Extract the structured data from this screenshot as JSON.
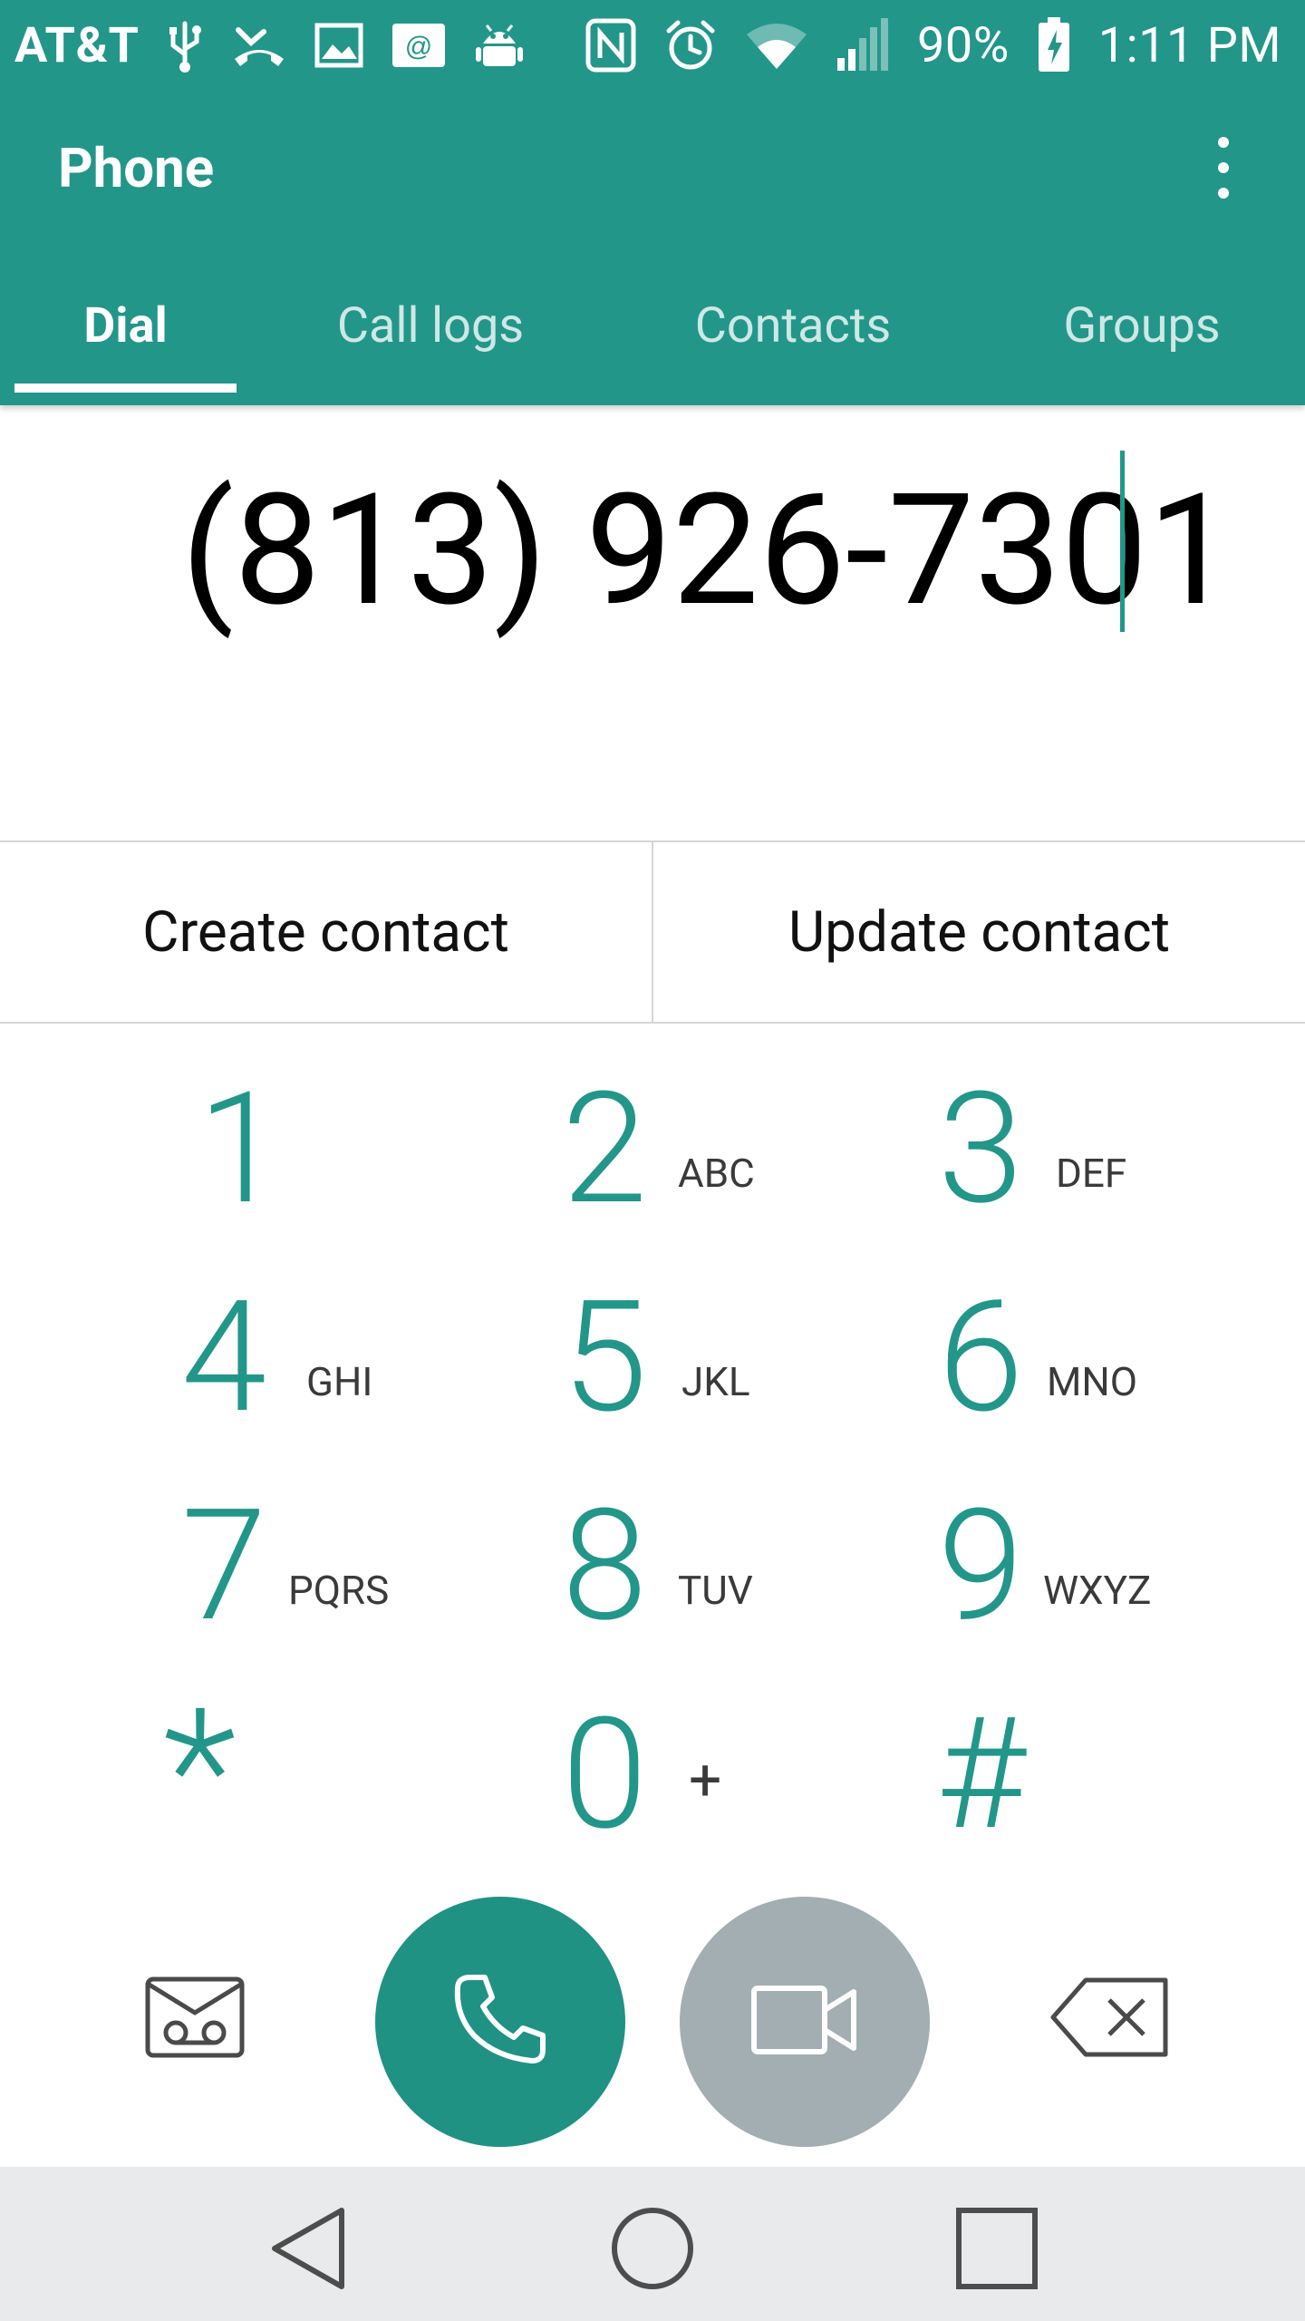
{
  "status_bar": {
    "carrier": "AT&T",
    "battery_percent": "90%",
    "time": "1:11 PM",
    "left_icons": [
      "usb-icon",
      "missed-call-icon",
      "image-icon",
      "email-icon",
      "android-icon"
    ],
    "right_icons": [
      "nfc-icon",
      "alarm-icon",
      "wifi-icon",
      "signal-icon",
      "battery-charging-icon"
    ]
  },
  "app_bar": {
    "title": "Phone",
    "overflow_icon": "more-vert-icon"
  },
  "tabs": [
    {
      "label": "Dial",
      "active": true
    },
    {
      "label": "Call logs",
      "active": false
    },
    {
      "label": "Contacts",
      "active": false
    },
    {
      "label": "Groups",
      "active": false
    }
  ],
  "dialer": {
    "number": "(813) 926-7301"
  },
  "contact_actions": {
    "create": "Create contact",
    "update": "Update contact"
  },
  "dialpad": {
    "keys": [
      {
        "digit": "1",
        "letters": ""
      },
      {
        "digit": "2",
        "letters": "ABC"
      },
      {
        "digit": "3",
        "letters": "DEF"
      },
      {
        "digit": "4",
        "letters": "GHI"
      },
      {
        "digit": "5",
        "letters": "JKL"
      },
      {
        "digit": "6",
        "letters": "MNO"
      },
      {
        "digit": "7",
        "letters": "PQRS"
      },
      {
        "digit": "8",
        "letters": "TUV"
      },
      {
        "digit": "9",
        "letters": "WXYZ"
      },
      {
        "digit": "*",
        "letters": ""
      },
      {
        "digit": "0",
        "letters": "+"
      },
      {
        "digit": "#",
        "letters": ""
      }
    ]
  },
  "actions": {
    "voicemail_icon": "voicemail-icon",
    "call_icon": "phone-icon",
    "video_call_icon": "video-camera-icon",
    "backspace_icon": "backspace-icon"
  },
  "nav_bar": {
    "back_icon": "back-triangle-icon",
    "home_icon": "home-circle-icon",
    "recents_icon": "recents-square-icon"
  },
  "colors": {
    "primary": "#23968a",
    "call_button": "#1f9284",
    "video_button": "#a3aeb3",
    "nav_bar": "#e9eaec"
  }
}
